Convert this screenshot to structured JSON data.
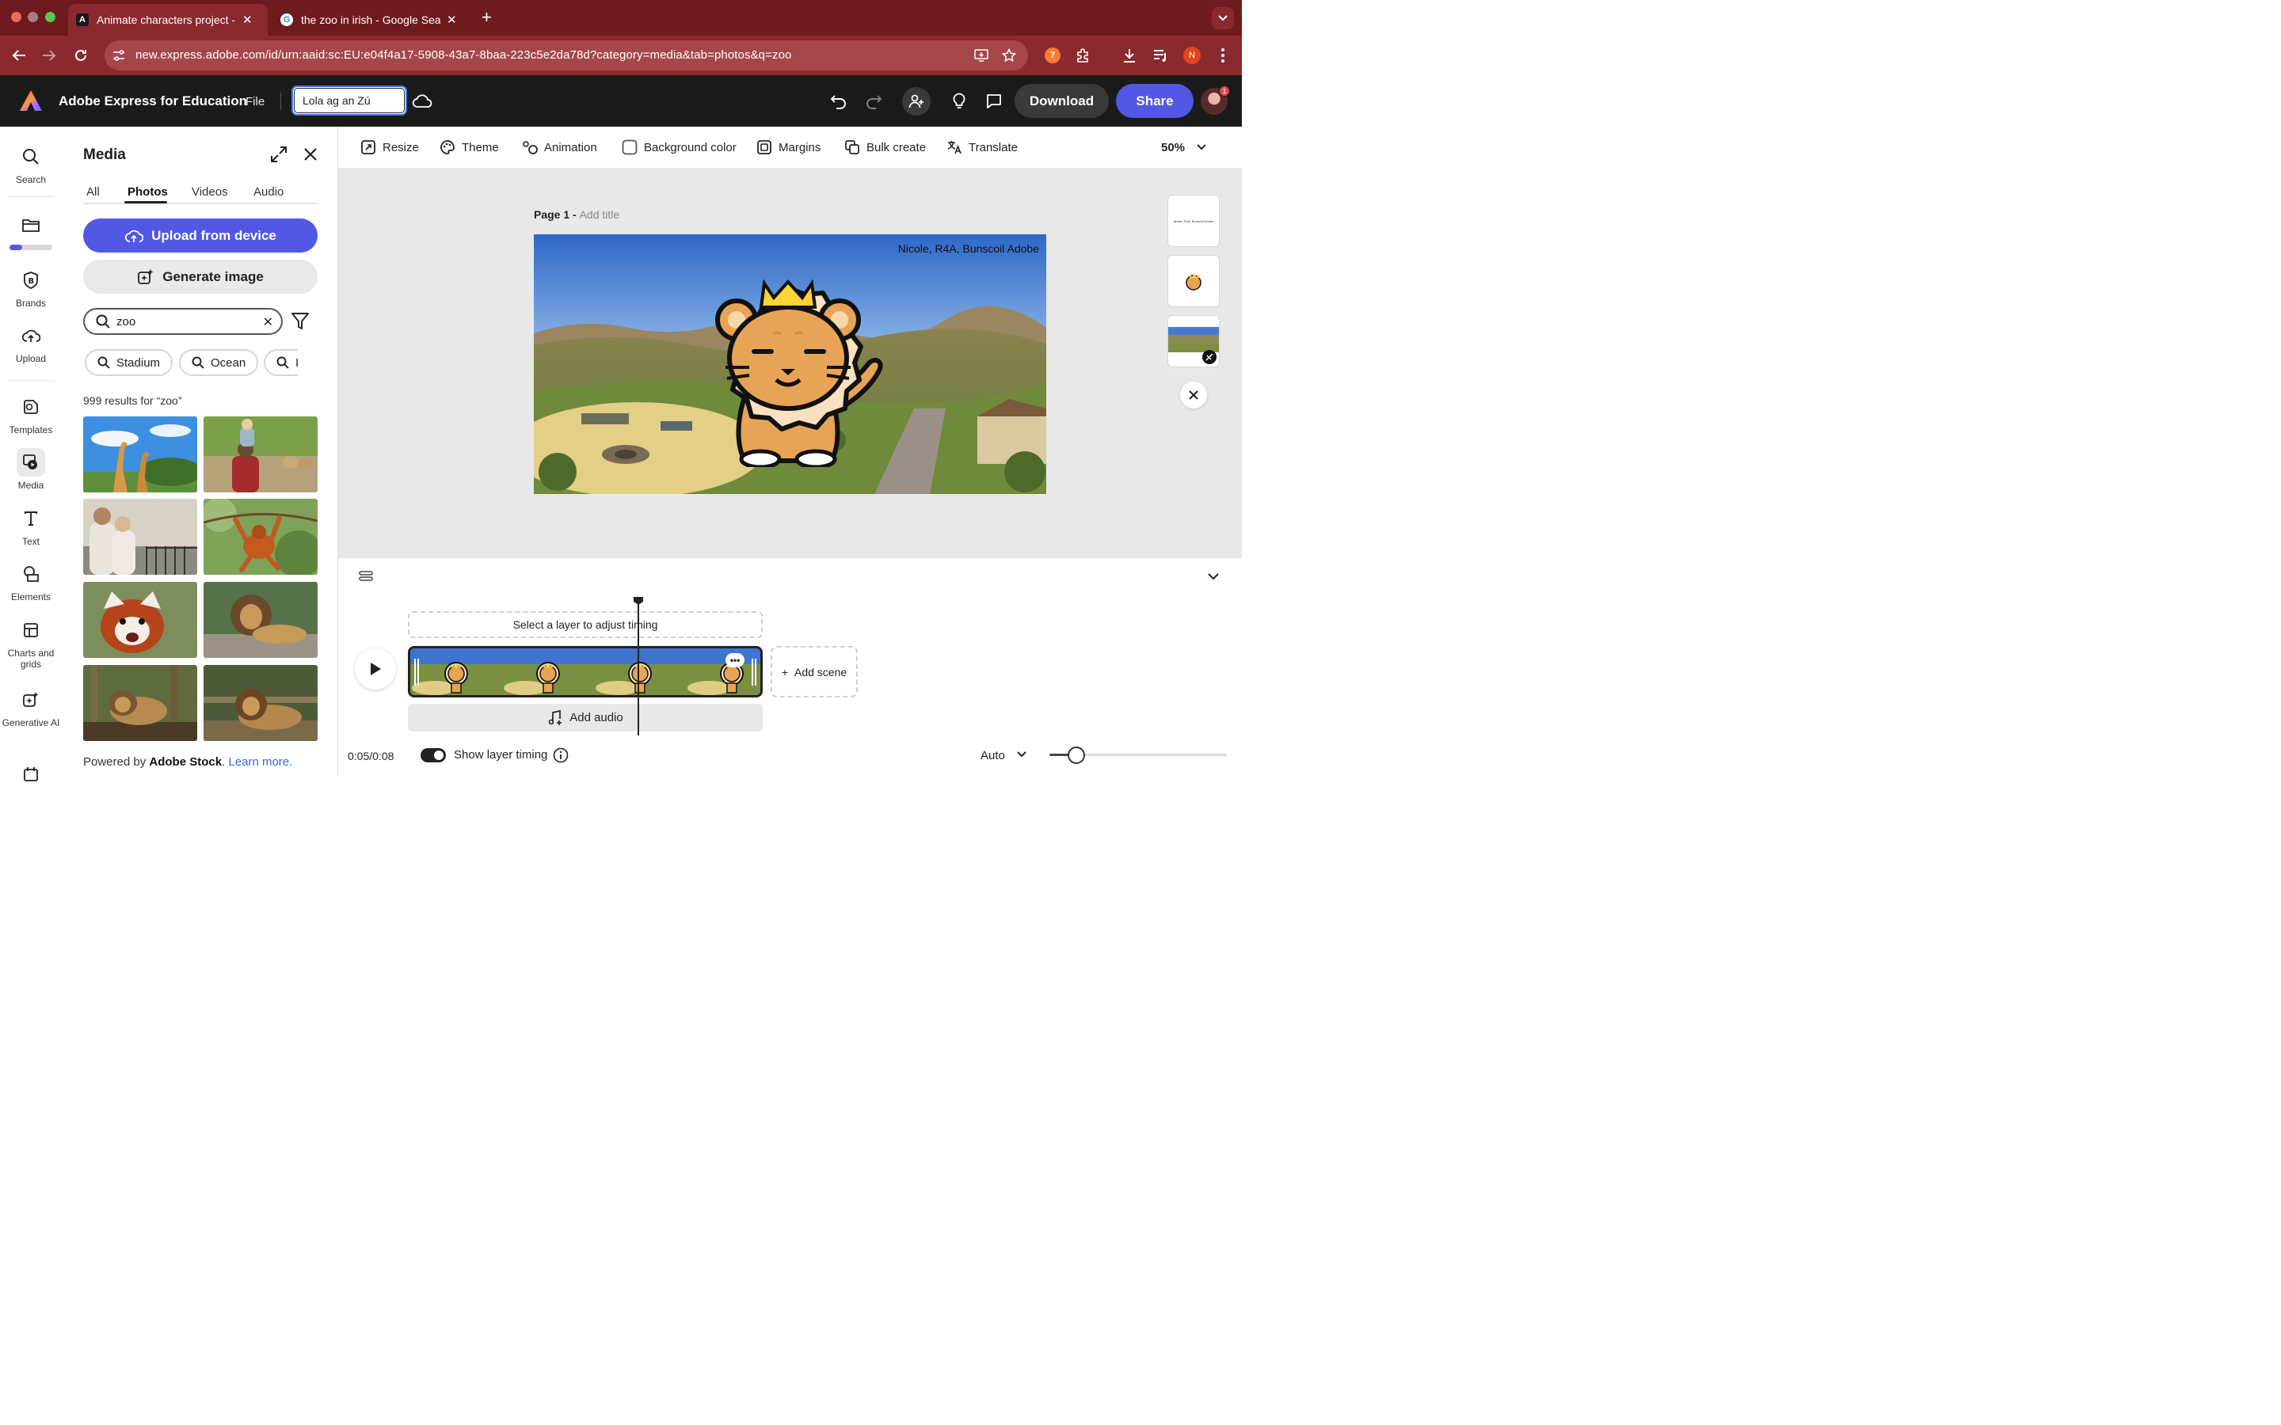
{
  "browser": {
    "tabs": [
      {
        "title": "Animate characters project - Adobe Express",
        "active": true
      },
      {
        "title": "the zoo in irish - Google Search",
        "active": false
      }
    ],
    "new_tab": "+",
    "url": "new.express.adobe.com/id/urn:aaid:sc:EU:e04f4a17-5908-43a7-8baa-223c5e2da78d?category=media&tab=photos&q=zoo",
    "profile_initial": "N",
    "close_glyph": "✕"
  },
  "app": {
    "title": "Adobe Express for Education",
    "file_menu": "File",
    "document_title": "Lola ag an Zú",
    "download_label": "Download",
    "share_label": "Share",
    "notification_count": "1",
    "brand_color": "#5258e4"
  },
  "rail": {
    "items": [
      {
        "label": "Search",
        "icon": "search-icon"
      },
      {
        "label": "Brands",
        "icon": "brands-icon"
      },
      {
        "label": "Upload",
        "icon": "upload-icon"
      },
      {
        "label": "Templates",
        "icon": "templates-icon"
      },
      {
        "label": "Media",
        "icon": "media-icon",
        "active": true
      },
      {
        "label": "Text",
        "icon": "text-icon"
      },
      {
        "label": "Elements",
        "icon": "elements-icon"
      },
      {
        "label": "Charts and grids",
        "icon": "charts-icon"
      },
      {
        "label": "Generative AI",
        "icon": "generative-ai-icon"
      }
    ],
    "storage_used_fraction": 0.3
  },
  "media_panel": {
    "title": "Media",
    "tabs": [
      {
        "label": "All"
      },
      {
        "label": "Photos",
        "active": true
      },
      {
        "label": "Videos"
      },
      {
        "label": "Audio"
      }
    ],
    "upload_label": "Upload from device",
    "generate_label": "Generate image",
    "search_value": "zoo",
    "chips": [
      {
        "label": "Stadium"
      },
      {
        "label": "Ocean"
      },
      {
        "label": "I"
      }
    ],
    "results_text": "999 results for “zoo”",
    "photos": [
      {
        "subject": "giraffes"
      },
      {
        "subject": "child on shoulders at zoo"
      },
      {
        "subject": "couple at zoo fence"
      },
      {
        "subject": "orangutan on rope"
      },
      {
        "subject": "red panda"
      },
      {
        "subject": "lion on rock"
      },
      {
        "subject": "lion resting"
      },
      {
        "subject": "lion lying down"
      }
    ],
    "powered_prefix": "Powered by ",
    "powered_brand": "Adobe Stock",
    "powered_period": ".",
    "learn_more": "Learn more."
  },
  "canvas_toolbar": {
    "items": [
      {
        "label": "Resize",
        "icon": "resize-icon"
      },
      {
        "label": "Theme",
        "icon": "theme-icon"
      },
      {
        "label": "Animation",
        "icon": "animation-icon"
      },
      {
        "label": "Background color",
        "icon": "background-color-icon"
      },
      {
        "label": "Margins",
        "icon": "margins-icon"
      },
      {
        "label": "Bulk create",
        "icon": "bulk-create-icon"
      },
      {
        "label": "Translate",
        "icon": "translate-icon"
      }
    ],
    "zoom": "50%"
  },
  "canvas": {
    "page_label": "Page 1 - ",
    "add_title": "Add title",
    "credit": "Nicole, R4A, Bunscoil Adobe",
    "thumb_text": "Nicole, R4A, Bunscoil Adobe"
  },
  "timeline": {
    "hint": "Select a layer to adjust timing",
    "add_scene": "Add scene",
    "add_audio": "Add audio",
    "time": "0:05/0:08",
    "show_layer_timing": "Show layer timing",
    "show_layer_timing_on": true,
    "auto": "Auto",
    "scene_zoom_fraction": 0.15,
    "playhead_fraction": 0.65
  }
}
